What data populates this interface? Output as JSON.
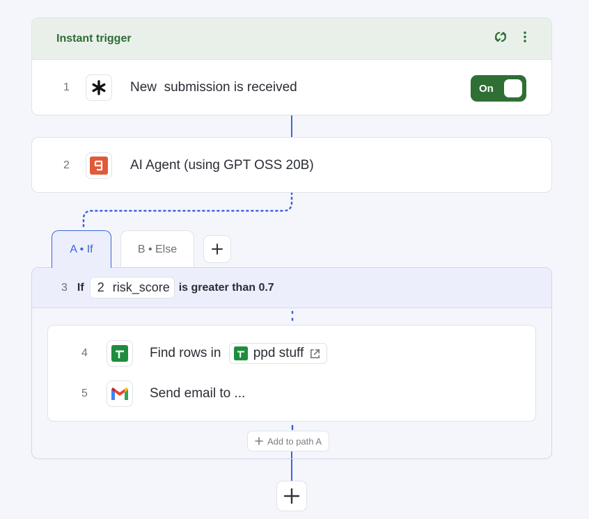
{
  "trigger": {
    "title": "Instant trigger",
    "step_number": "1",
    "step_label": "New  submission is received",
    "toggle_label": "On"
  },
  "agent": {
    "step_number": "2",
    "step_label": "AI Agent (using GPT OSS 20B)"
  },
  "tabs": [
    {
      "label": "A • If",
      "active": true
    },
    {
      "label": "B • Else",
      "active": false
    }
  ],
  "condition": {
    "step_number": "3",
    "prefix": "If",
    "chip_number": "2",
    "chip_field": "risk_score",
    "operator": "is greater than 0.7"
  },
  "path_steps": [
    {
      "step_number": "4",
      "label": "Find rows in",
      "ref": "ppd stuff",
      "icon": "google-sheets-icon"
    },
    {
      "step_number": "5",
      "label": "Send email to ...",
      "icon": "gmail-icon"
    }
  ],
  "add_path_label": "Add to path A",
  "colors": {
    "trigger_green": "#2f6f34",
    "connector_blue": "#3b63d9",
    "ai_icon_red": "#e05a3a",
    "sheets_green": "#1e8e3e"
  }
}
